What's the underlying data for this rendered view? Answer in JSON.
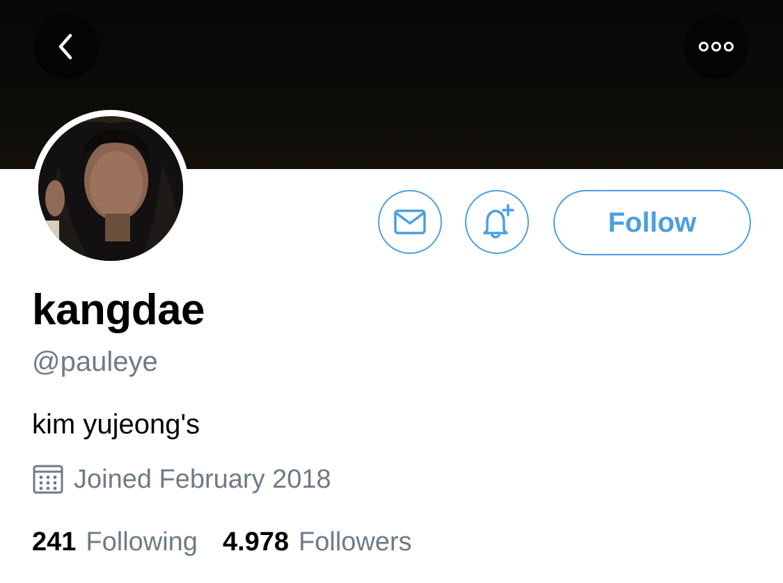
{
  "profile": {
    "display_name": "kangdae",
    "handle": "@pauleye",
    "bio": "kim yujeong's",
    "joined": "Joined February 2018"
  },
  "stats": {
    "following_count": "241",
    "following_label": "Following",
    "followers_count": "4.978",
    "followers_label": "Followers"
  },
  "actions": {
    "follow_label": "Follow"
  },
  "icons": {
    "back": "chevron-left-icon",
    "more": "ellipsis-icon",
    "message": "envelope-icon",
    "notify": "bell-plus-icon",
    "joined": "calendar-icon"
  },
  "colors": {
    "accent": "#4a9fe0",
    "secondary_text": "#6e7b86",
    "banner": "#0a0a0a"
  }
}
